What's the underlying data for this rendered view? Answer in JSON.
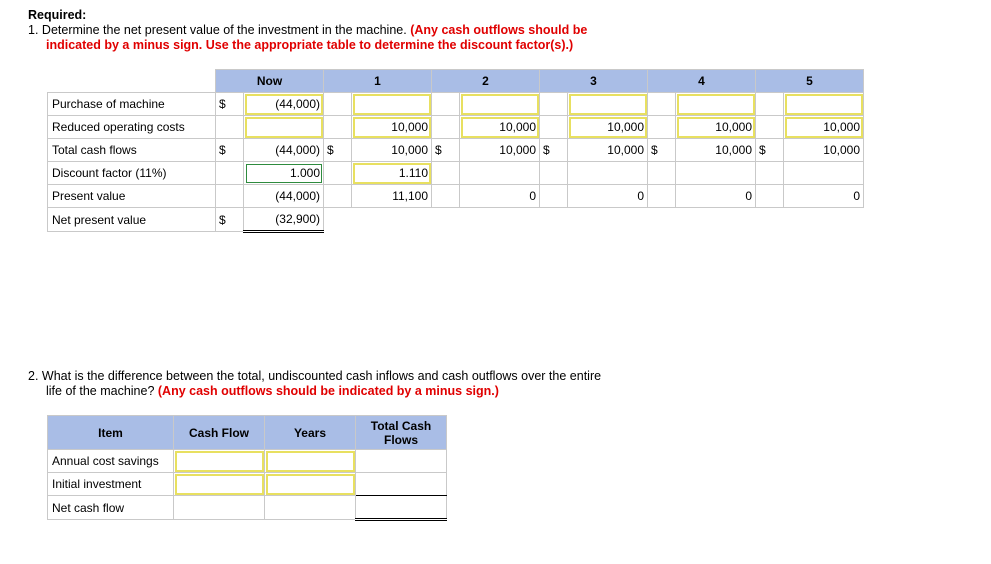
{
  "heading": "Required:",
  "q1": {
    "number": "1.",
    "text": "Determine the net present value of the investment in the machine.",
    "note_a": "(Any cash outflows should be",
    "note_b": "indicated by a minus sign. Use the appropriate table to determine the discount factor(s).)"
  },
  "npv_table": {
    "headers": [
      "Now",
      "1",
      "2",
      "3",
      "4",
      "5"
    ],
    "rows": {
      "purchase": {
        "label": "Purchase of machine",
        "cur": "$",
        "now": "(44,000)"
      },
      "reduced": {
        "label": "Reduced operating costs",
        "y1": "10,000",
        "y2": "10,000",
        "y3": "10,000",
        "y4": "10,000",
        "y5": "10,000"
      },
      "total": {
        "label": "Total cash flows",
        "cur": "$",
        "now": "(44,000)",
        "now_cur": "$",
        "y1": "10,000",
        "y1_cur": "$",
        "y2": "10,000",
        "y2_cur": "$",
        "y3": "10,000",
        "y3_cur": "$",
        "y4": "10,000",
        "y4_cur": "$",
        "y5": "10,000"
      },
      "discount": {
        "label": "Discount factor (11%)",
        "now": "1.000",
        "y1": "1.110"
      },
      "present": {
        "label": "Present value",
        "now": "(44,000)",
        "y1": "11,100",
        "y2": "0",
        "y3": "0",
        "y4": "0",
        "y5": "0"
      },
      "npv": {
        "label": "Net present value",
        "cur": "$",
        "now": "(32,900)"
      }
    }
  },
  "q2": {
    "number": "2.",
    "text_a": "What is the difference between the total, undiscounted cash inflows and cash outflows over the entire",
    "text_b": "life of the machine?",
    "note": "(Any cash outflows should be indicated by a minus sign.)"
  },
  "diff_table": {
    "headers": {
      "item": "Item",
      "cash_flow": "Cash Flow",
      "years": "Years",
      "total_a": "Total Cash",
      "total_b": "Flows"
    },
    "rows": [
      "Annual cost savings",
      "Initial investment",
      "Net cash flow"
    ]
  }
}
